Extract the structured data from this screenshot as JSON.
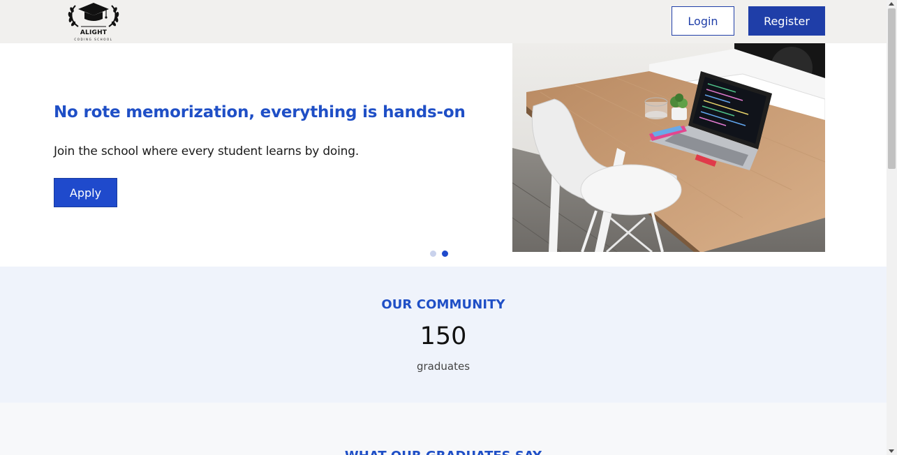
{
  "header": {
    "logo": {
      "icon": "graduation-cap-laurel-logo",
      "name": "ALIGHT",
      "subtitle": "CODING SCHOOL"
    },
    "login_label": "Login",
    "register_label": "Register"
  },
  "hero": {
    "title": "No rote memorization, everything is hands-on",
    "subtitle": "Join the school where every student learns by doing.",
    "apply_label": "Apply",
    "image": "desk-laptop-photo",
    "carousel": {
      "slide_count": 2,
      "active_index": 1
    }
  },
  "community": {
    "title": "OUR COMMUNITY",
    "number": "150",
    "label": "graduates"
  },
  "testimonials": {
    "title": "WHAT OUR GRADUATES SAY"
  },
  "colors": {
    "primary": "#1f4acc",
    "heading": "#1f4fc6",
    "header_bg": "#f1f0ee",
    "community_bg": "#eff3fb"
  }
}
